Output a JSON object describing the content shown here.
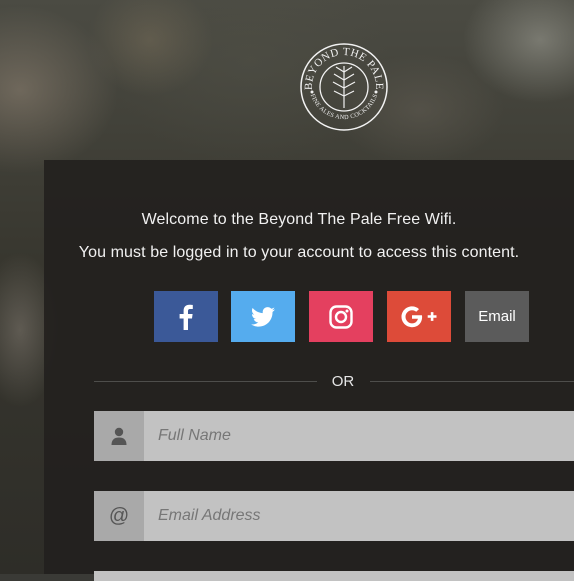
{
  "logo": {
    "top_text": "BEYOND THE PALE",
    "bottom_text": "FINE ALES AND COCKTAILS"
  },
  "welcome": {
    "line1": "Welcome to the Beyond The Pale Free Wifi.",
    "line2": "You must be logged in to your account to access this content."
  },
  "social": {
    "facebook_icon": "facebook-icon",
    "twitter_icon": "twitter-icon",
    "instagram_icon": "instagram-icon",
    "google_plus_icon": "google-plus-icon",
    "email_label": "Email",
    "colors": {
      "facebook": "#3b5998",
      "twitter": "#55acee",
      "instagram": "#e4405f",
      "google_plus": "#dd4b39",
      "email": "#5b5b5b"
    }
  },
  "divider": {
    "label": "OR"
  },
  "form": {
    "full_name_placeholder": "Full Name",
    "email_placeholder": "Email Address",
    "name_icon": "user-icon",
    "email_icon": "at-icon",
    "email_icon_glyph": "@"
  }
}
